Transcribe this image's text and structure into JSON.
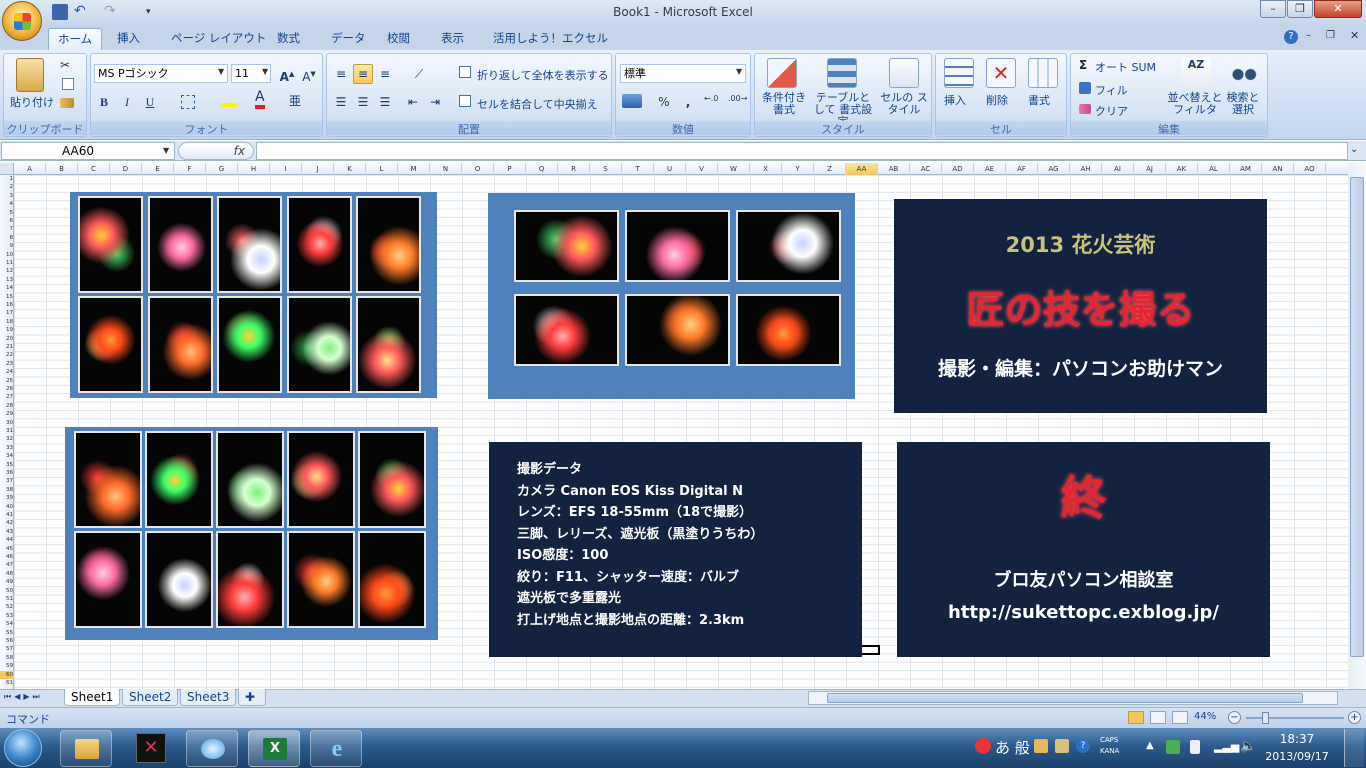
{
  "window": {
    "title": "Book1 - Microsoft Excel"
  },
  "tabs": [
    "ホーム",
    "挿入",
    "ページ レイアウト",
    "数式",
    "データ",
    "校閲",
    "表示",
    "活用しよう！エクセル"
  ],
  "ribbon": {
    "clipboard": {
      "paste": "貼り付け",
      "label": "クリップボード"
    },
    "font": {
      "name": "MS Pゴシック",
      "size": "11",
      "label": "フォント",
      "bold": "B",
      "italic": "I",
      "underline": "U",
      "color_a": "A",
      "furigana": "亜"
    },
    "alignment": {
      "wrap": "折り返して全体を表示する",
      "merge": "セルを結合して中央揃え",
      "label": "配置"
    },
    "number": {
      "format": "標準",
      "percent": "%",
      "comma": ",",
      "label": "数値"
    },
    "styles": {
      "conditional": "条件付き 書式",
      "table": "テーブルとして 書式設定",
      "cell": "セルの スタイル",
      "label": "スタイル"
    },
    "cells": {
      "insert": "挿入",
      "delete": "削除",
      "format": "書式",
      "label": "セル"
    },
    "editing": {
      "autosum": "オート SUM",
      "fill": "フィル",
      "clear": "クリア",
      "sort": "並べ替えと フィルタ",
      "find": "検索と 選択",
      "label": "編集"
    }
  },
  "formula_bar": {
    "name_box": "AA60",
    "fx": "fx",
    "value": ""
  },
  "columns": [
    "A",
    "B",
    "C",
    "D",
    "E",
    "F",
    "G",
    "H",
    "I",
    "J",
    "K",
    "L",
    "M",
    "N",
    "O",
    "P",
    "Q",
    "R",
    "S",
    "T",
    "U",
    "V",
    "W",
    "X",
    "Y",
    "Z",
    "AA",
    "AB",
    "AC",
    "AD",
    "AE",
    "AF",
    "AG",
    "AH",
    "AI",
    "AJ",
    "AK",
    "AL",
    "AM",
    "AN",
    "AO"
  ],
  "selected_column": "AA",
  "title_card": {
    "year": "2013 花火芸術",
    "headline": "匠の技を撮る",
    "credit": "撮影・編集：パソコンお助けマン"
  },
  "shooting_data": {
    "lines": [
      "撮影データ",
      "カメラ  Canon EOS Kiss Digital N",
      "レンズ：EFS 18-55mm（18で撮影）",
      "三脚、レリーズ、遮光板（黒塗りうちわ）",
      "ISO感度：100",
      "絞り：F11、シャッター速度：バルブ",
      "遮光板で多重露光",
      "打上げ地点と撮影地点の距離：2.3km"
    ]
  },
  "end_card": {
    "end": "終",
    "blog": "ブロ友パソコン相談室",
    "url": "http://sukettopc.exblog.jp/"
  },
  "sheets": [
    "Sheet1",
    "Sheet2",
    "Sheet3"
  ],
  "status": {
    "mode": "コマンド",
    "zoom": "44%"
  },
  "taskbar": {
    "ime": "あ 般",
    "caps": "CAPS",
    "kana": "KANA",
    "time": "18:37",
    "date": "2013/09/17"
  },
  "colors": {
    "panel_blue": "#4f81bd",
    "navy": "#13233f",
    "title_gold": "#c8c27a",
    "headline_red": "#e3262f"
  }
}
